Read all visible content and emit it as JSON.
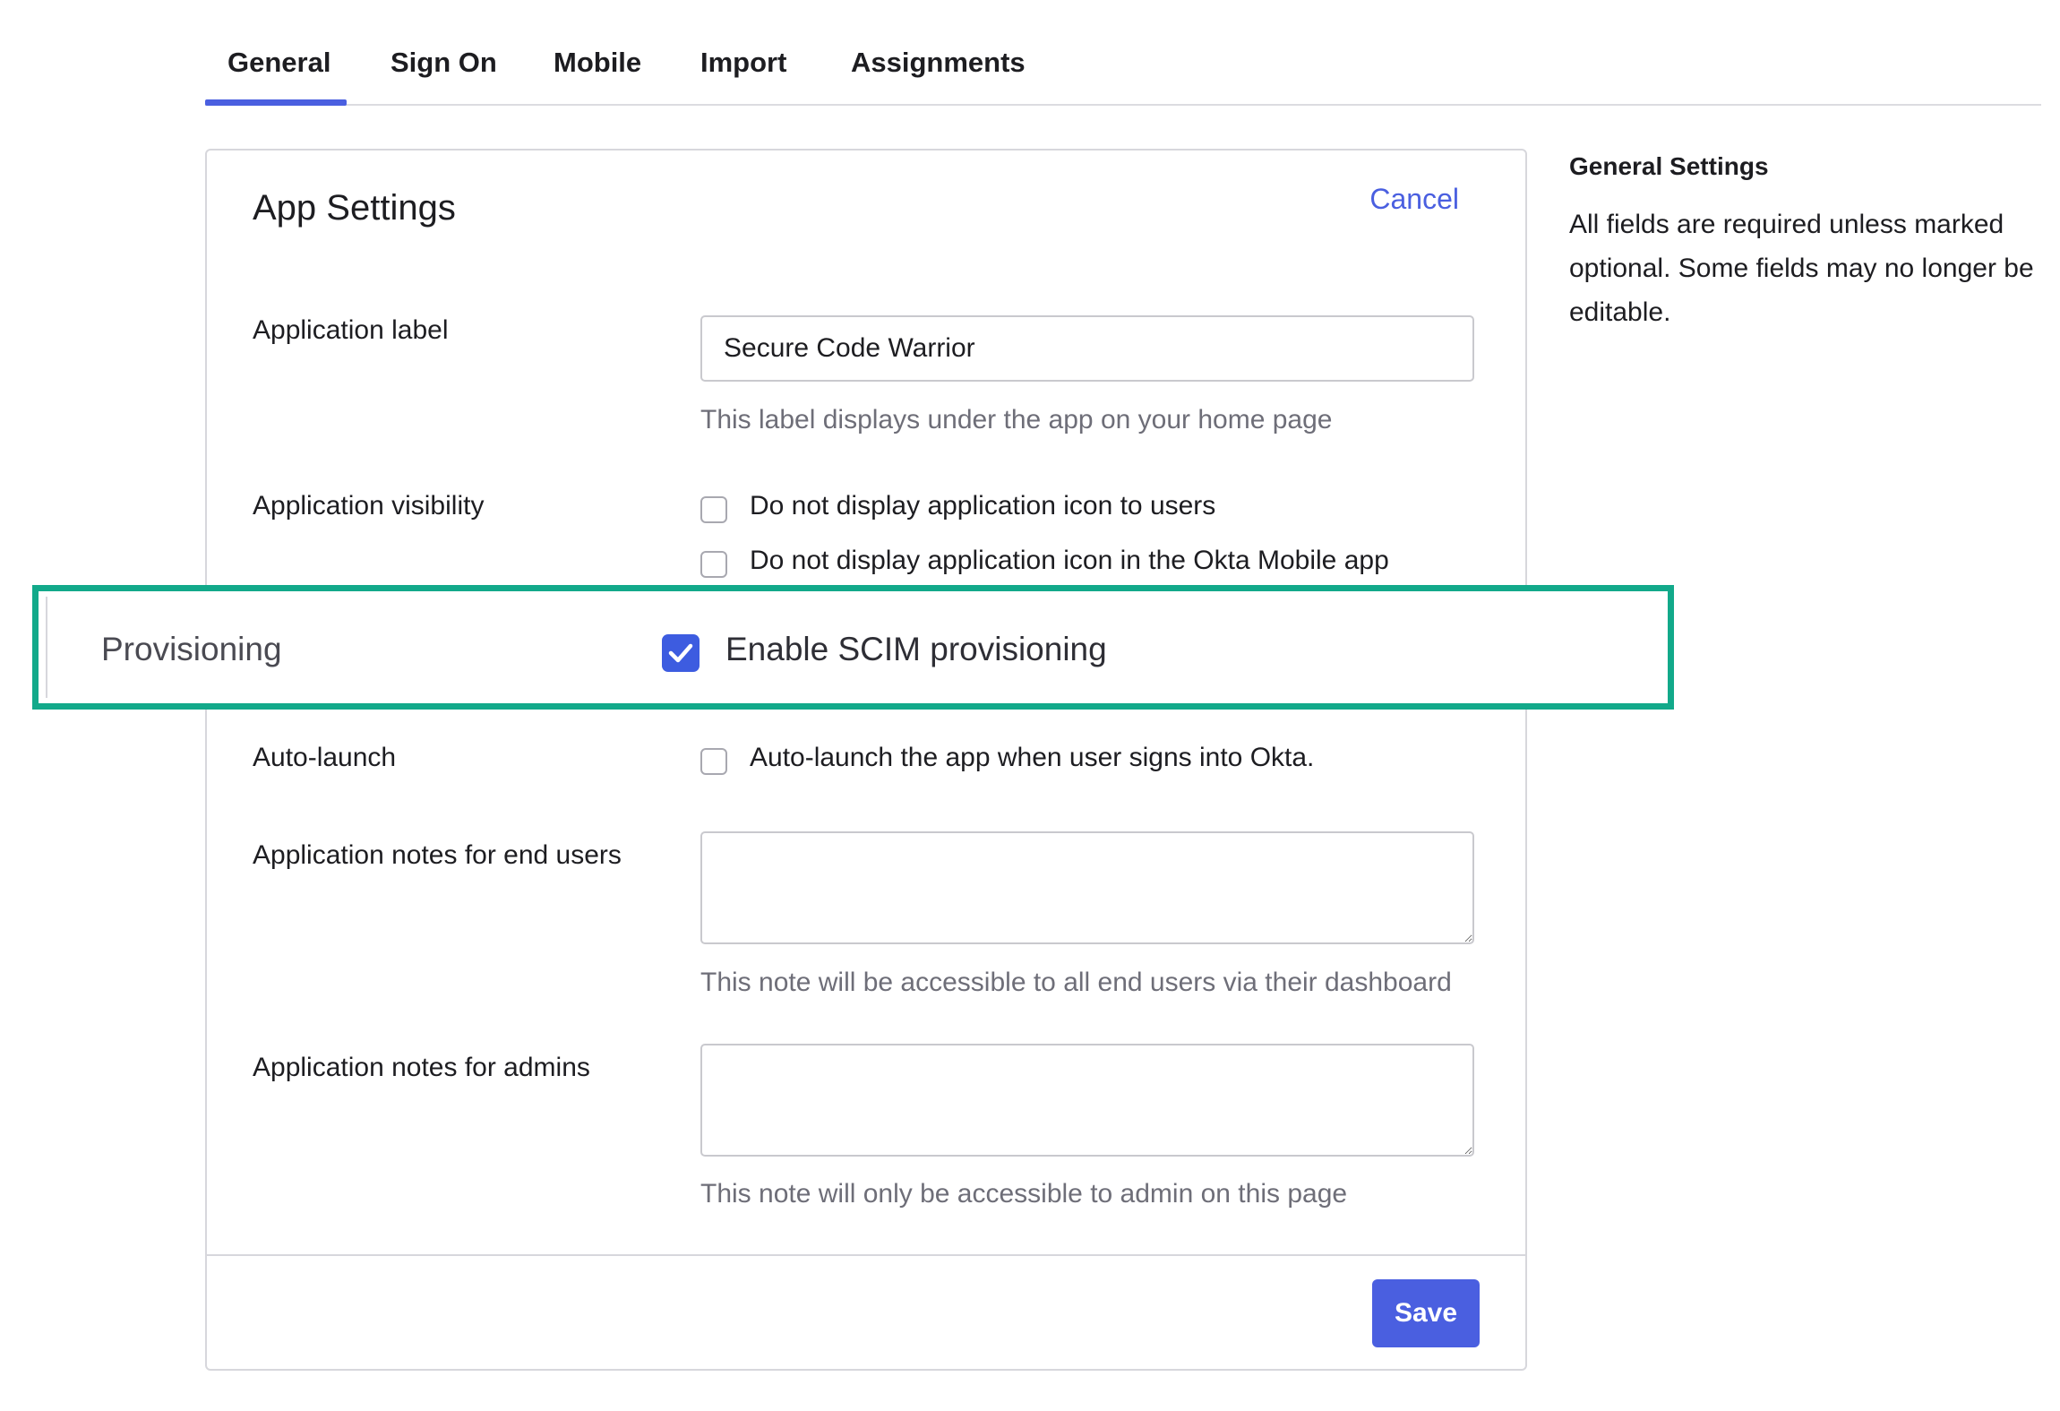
{
  "tabs": [
    {
      "label": "General",
      "active": true
    },
    {
      "label": "Sign On",
      "active": false
    },
    {
      "label": "Mobile",
      "active": false
    },
    {
      "label": "Import",
      "active": false
    },
    {
      "label": "Assignments",
      "active": false
    }
  ],
  "card": {
    "title": "App Settings",
    "cancel_label": "Cancel",
    "app_label": {
      "label": "Application label",
      "value": "Secure Code Warrior",
      "help": "This label displays under the app on your home page"
    },
    "visibility": {
      "label": "Application visibility",
      "options": [
        {
          "label": "Do not display application icon to users",
          "checked": false
        },
        {
          "label": "Do not display application icon in the Okta Mobile app",
          "checked": false
        }
      ]
    },
    "provisioning": {
      "label": "Provisioning",
      "option_label": "Enable SCIM provisioning",
      "checked": true
    },
    "auto_launch": {
      "label": "Auto-launch",
      "option_label": "Auto-launch the app when user signs into Okta.",
      "checked": false
    },
    "notes_end_users": {
      "label": "Application notes for end users",
      "value": "",
      "help": "This note will be accessible to all end users via their dashboard"
    },
    "notes_admins": {
      "label": "Application notes for admins",
      "value": "",
      "help": "This note will only be accessible to admin on this page"
    },
    "save_label": "Save"
  },
  "side_panel": {
    "title": "General Settings",
    "description": "All fields are required unless marked optional. Some fields may no longer be editable."
  },
  "colors": {
    "accent": "#4a5fe0",
    "highlight_border": "#12a98a",
    "checkbox_checked": "#3d5ce0"
  }
}
